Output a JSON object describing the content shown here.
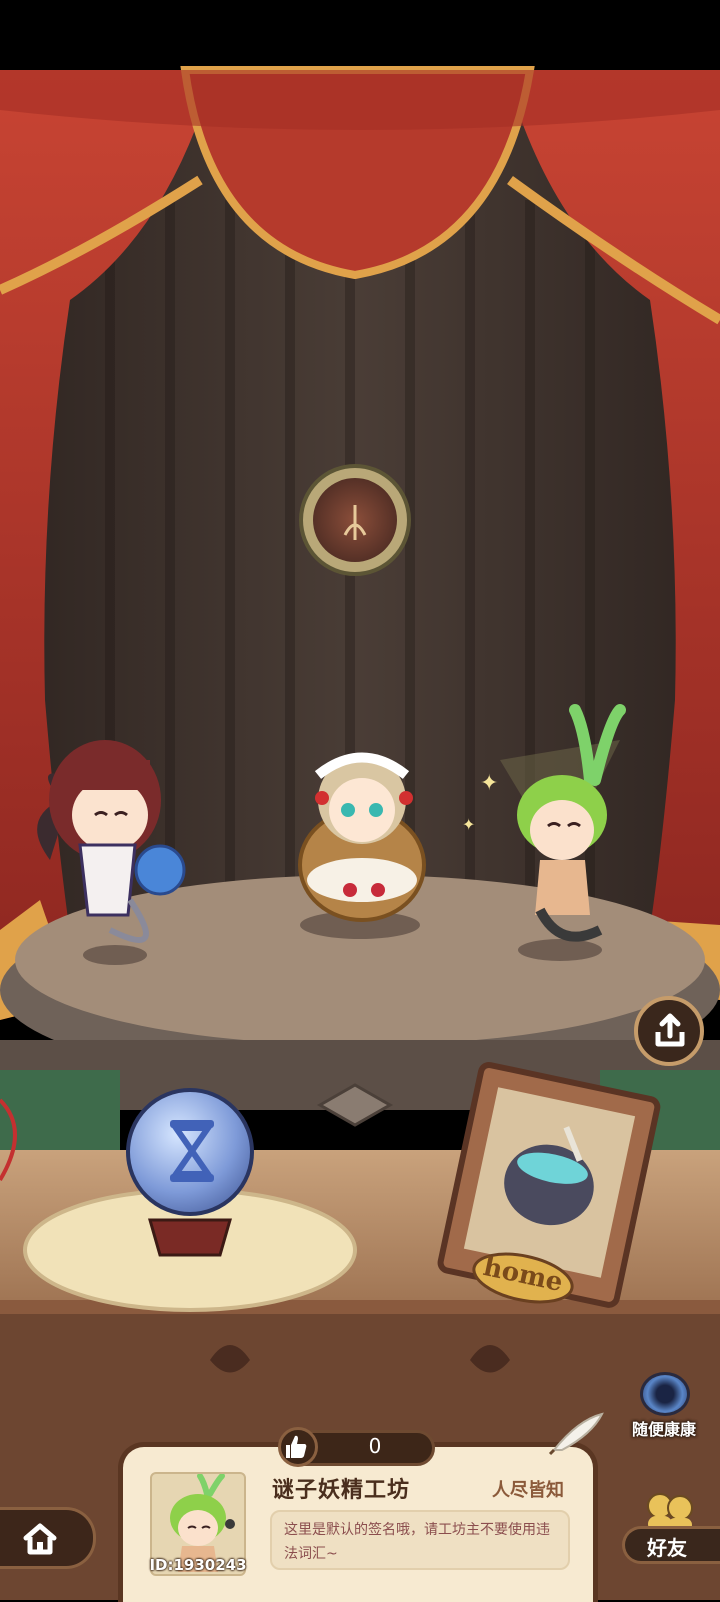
{
  "workshop": {
    "name": "谜子妖精工坊",
    "title": "人尽皆知",
    "signature": "这里是默认的签名哦，请工坊主不要使用违法词汇~",
    "id_label": "ID:1930243",
    "likes": "0"
  },
  "buttons": {
    "random_visit": "随便康康",
    "friends": "好友",
    "home_sign": "home"
  },
  "icons": {
    "share": "share-icon",
    "hourglass": "hourglass-icon",
    "home": "house-icon",
    "like": "thumbs-up-icon",
    "portal": "portal-icon",
    "quill": "quill-icon"
  },
  "colors": {
    "curtain": "#b0352a",
    "curtain_gold": "#e0a24a",
    "backdrop": "#3b2f2a",
    "stage": "#a38d79",
    "card_bg": "#f7ead1",
    "card_border": "#5a3622"
  }
}
